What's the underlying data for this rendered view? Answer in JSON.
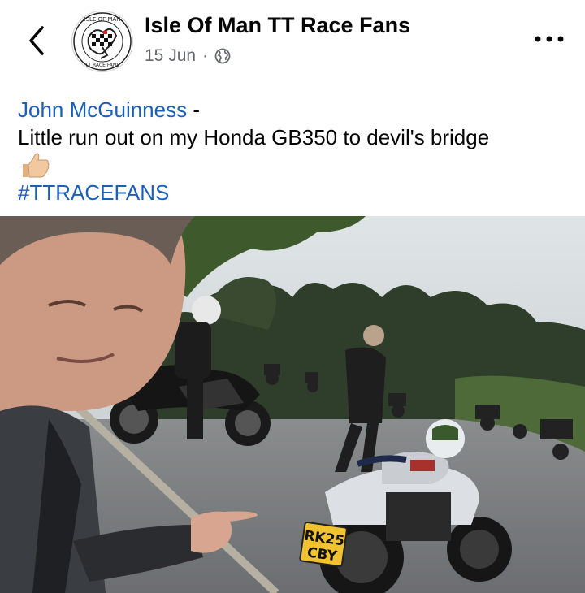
{
  "header": {
    "page_name": "Isle Of Man TT Race Fans",
    "date": "15 Jun",
    "separator": "·",
    "privacy_icon": "globe-icon",
    "back_icon": "chevron-left-icon",
    "more_icon": "ellipsis-icon",
    "logo_text_top": "ISLE OF MAN",
    "logo_text_bottom": "TT RACE FANS"
  },
  "post": {
    "author_link": "John McGuinness",
    "author_suffix": " -",
    "body": "Little run out on my Honda GB350 to devil's bridge",
    "emoji": "thumbs-up-icon",
    "hashtag": "#TTRACEFANS"
  },
  "photo": {
    "plate_line1": "RK25",
    "plate_line2": "CBY"
  },
  "colors": {
    "link": "#1c5fb8",
    "meta": "#65676b",
    "text": "#050505"
  }
}
